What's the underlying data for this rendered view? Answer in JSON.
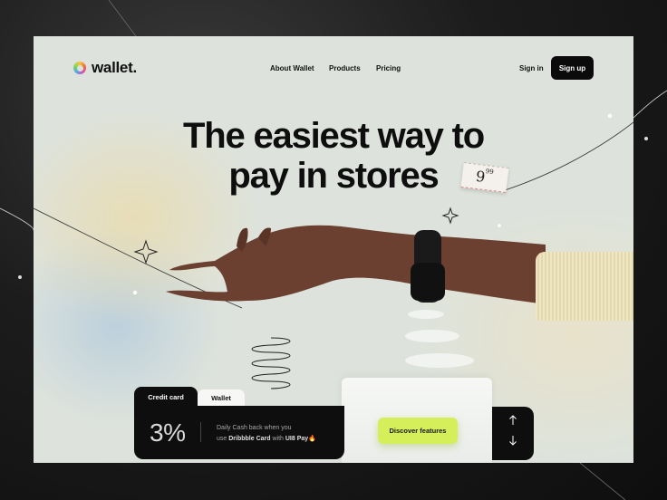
{
  "brand": {
    "name": "wallet."
  },
  "nav": {
    "items": [
      {
        "label": "About Wallet"
      },
      {
        "label": "Products"
      },
      {
        "label": "Pricing"
      }
    ],
    "signin_label": "Sign in",
    "signup_label": "Sign up"
  },
  "hero": {
    "headline_line1": "The easiest way to",
    "headline_line2": "pay in stores",
    "price_main": "9",
    "price_cents": "99"
  },
  "card_tabs": {
    "tabs": [
      {
        "label": "Credit card",
        "active": true
      },
      {
        "label": "Wallet",
        "active": false
      }
    ]
  },
  "cashback": {
    "percent": "3%",
    "line1": "Daily Cash back when you",
    "line2_prefix": "use ",
    "line2_bold1": "Dribbble Card",
    "line2_mid": " with ",
    "line2_bold2": "UI8 Pay",
    "line2_emoji": "🔥"
  },
  "cta": {
    "discover_label": "Discover features"
  },
  "pager": {
    "up_icon": "arrow-up-icon",
    "down_icon": "arrow-down-icon"
  },
  "colors": {
    "accent": "#d4ef5a",
    "dark": "#0e0e0e",
    "background": "#dde3dc"
  }
}
